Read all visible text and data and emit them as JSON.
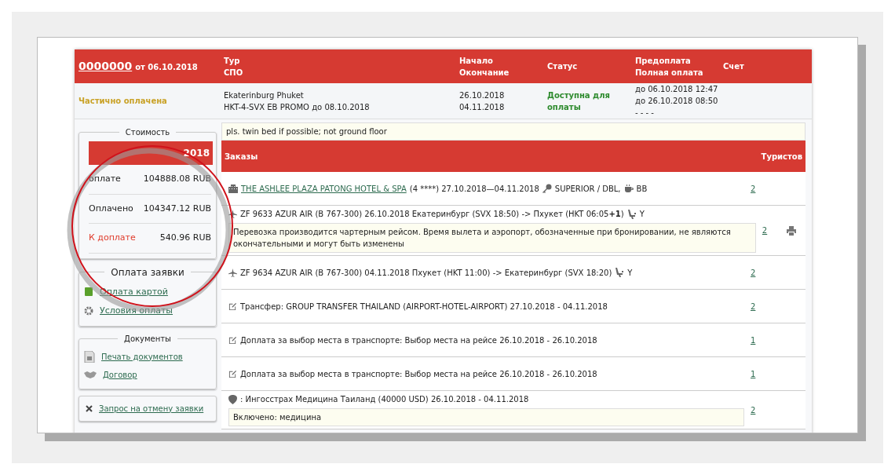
{
  "header": {
    "number": "0000000",
    "date_text": "от 06.10.2018",
    "tour": [
      "Тур",
      "СПО"
    ],
    "dates": [
      "Начало",
      "Окончание"
    ],
    "status": "Статус",
    "payment": [
      "Предоплата",
      "Полная оплата"
    ],
    "invoice": "Счет"
  },
  "summary": {
    "state": "Частично оплачена",
    "tour": [
      "Ekaterinburg Phuket",
      "HKT-4-SVX EB PROMO до 08.10.2018"
    ],
    "dates": [
      "26.10.2018",
      "04.11.2018"
    ],
    "availability": "Доступна для оплаты",
    "payment": [
      "до 06.10.2018 12:47",
      "до 26.10.2018 08:50",
      "- - - -"
    ]
  },
  "cost": {
    "title": "Стоимость",
    "header": "2018",
    "rows": [
      {
        "label": "оплате",
        "amount": "104888.08 RUB",
        "kind": "normal"
      },
      {
        "label": "Оплачено",
        "amount": "104347.12 RUB",
        "kind": "normal"
      },
      {
        "label": "К доплате",
        "amount": "540.96 RUB",
        "kind": "due"
      }
    ]
  },
  "payment_box": {
    "title": "Оплата заявки",
    "links": [
      {
        "label": "Оплата картой"
      },
      {
        "label": "Условия оплаты"
      }
    ]
  },
  "documents": {
    "title": "Документы",
    "links": [
      {
        "label": "Печать документов"
      },
      {
        "label": "Договор"
      }
    ]
  },
  "cancel": {
    "label": "Запрос на отмену заявки"
  },
  "note": "pls. twin bed if possible; not ground floor",
  "orders": {
    "title": "Заказы",
    "tourists": "Туристов",
    "items": [
      {
        "kind": "hotel",
        "link": "THE ASHLEE PLAZA PATONG HOTEL & SPA",
        "text": "(4 ****) 27.10.2018—04.11.2018",
        "room": "SUPERIOR / DBL,",
        "meal": "BB",
        "count": "2"
      },
      {
        "kind": "flight",
        "text": "ZF 9633 AZUR AIR (B 767-300) 26.10.2018 Екатеринбург (SVX 18:50) -> Пхукет (HKT 06:05**+1**)",
        "class": "Y",
        "note": "Перевозка производится чартерным рейсом. Время вылета и аэропорт, обозначенные при бронировании, не являются окончательными и могут быть изменены",
        "count": "2",
        "printable": true
      },
      {
        "kind": "flight",
        "text": "ZF 9634 AZUR AIR (B 767-300) 04.11.2018 Пхукет (HKT 11:00) -> Екатеринбург (SVX 18:20)",
        "class": "Y",
        "count": "2",
        "printable": false
      },
      {
        "kind": "service",
        "text": "Трансфер: GROUP TRANSFER THAILAND (AIRPORT-HOTEL-AIRPORT) 27.10.2018 - 04.11.2018",
        "count": "2"
      },
      {
        "kind": "service",
        "text": "Доплата за выбор места в транспорте: Выбор места на рейсе 26.10.2018 - 26.10.2018",
        "count": "1"
      },
      {
        "kind": "service",
        "text": "Доплата за выбор места в транспорте: Выбор места на рейсе 26.10.2018 - 26.10.2018",
        "count": "1"
      },
      {
        "kind": "insurance",
        "text": ": Ингосстрах Медицина Таиланд (40000 USD) 26.10.2018 - 04.11.2018",
        "note": "Включено: медицина",
        "count": "2"
      }
    ]
  }
}
